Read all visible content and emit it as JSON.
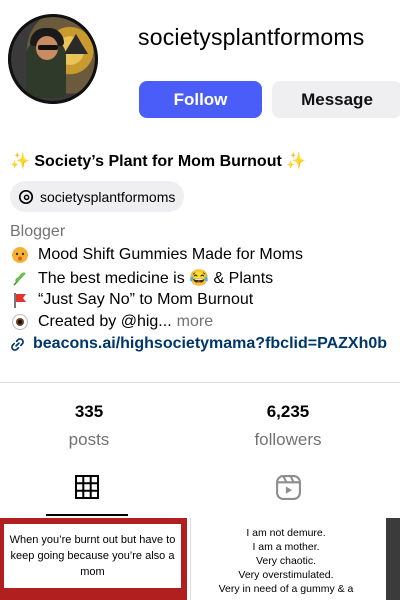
{
  "profile": {
    "username": "societysplantformoms",
    "full_name": "Society’s Plant for Mom Burnout",
    "threads_handle": "societysplantformoms",
    "category": "Blogger",
    "bio": [
      {
        "icon": "bubble-head-emoji",
        "text": "Mood Shift Gummies Made for Moms"
      },
      {
        "icon": "herb-emoji",
        "text": "The best medicine is 😂 & Plants"
      },
      {
        "icon": "red-flag-emoji",
        "text": "“Just Say No” to Mom Burnout"
      },
      {
        "icon": "eye-emoji",
        "text": "Created by @hig..."
      }
    ],
    "more_label": "more",
    "link": "beacons.ai/highsocietymama?fbclid=PAZXh0b"
  },
  "actions": {
    "follow_label": "Follow",
    "message_label": "Message"
  },
  "stats": {
    "posts": {
      "count": "335",
      "label": "posts"
    },
    "followers": {
      "count": "6,235",
      "label": "followers"
    }
  },
  "tabs": [
    {
      "icon": "grid-icon",
      "active": true
    },
    {
      "icon": "reels-icon",
      "active": false
    }
  ],
  "posts": [
    {
      "text": "When you’re burnt out but have to keep going because you’re also a mom"
    },
    {
      "text": "I am not demure.\nI am a mother.\nVery chaotic.\nVery overstimulated.\nVery in need of a gummy & a"
    }
  ],
  "colors": {
    "accent": "#4a5df9",
    "link": "#00376b",
    "muted": "#737373",
    "sparkle": "#f0c419"
  }
}
